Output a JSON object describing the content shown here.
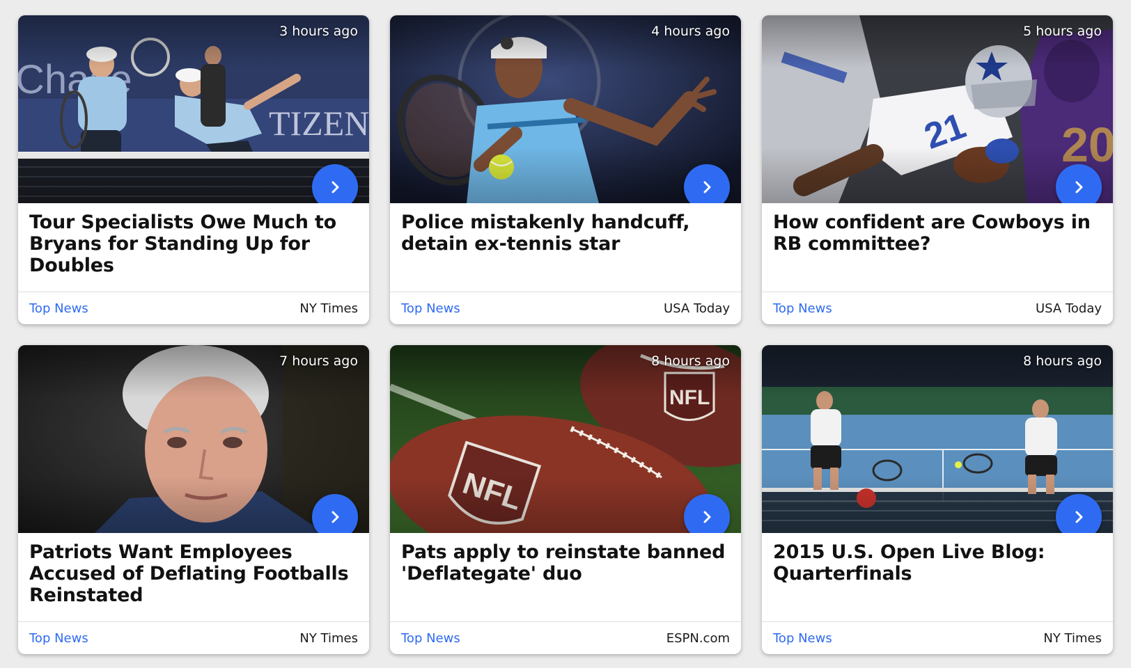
{
  "cards": [
    {
      "time": "3 hours ago",
      "headline": "Tour Specialists Owe Much to Bryans for Standing Up for Doubles",
      "category": "Top News",
      "source": "NY Times",
      "image_alt": "Doubles tennis players at net",
      "image_text": [
        "Chase",
        "TIZEN"
      ]
    },
    {
      "time": "4 hours ago",
      "headline": "Police mistakenly handcuff, detain ex-tennis star",
      "category": "Top News",
      "source": "USA Today",
      "image_alt": "Tennis player hitting forehand"
    },
    {
      "time": "5 hours ago",
      "headline": "How confident are Cowboys in RB committee?",
      "category": "Top News",
      "source": "USA Today",
      "image_alt": "Cowboys running back carrying the ball"
    },
    {
      "time": "7 hours ago",
      "headline": "Patriots Want Employees Accused of Deflating Footballs Reinstated",
      "category": "Top News",
      "source": "NY Times",
      "image_alt": "Portrait of team owner"
    },
    {
      "time": "8 hours ago",
      "headline": "Pats apply to reinstate banned 'Deflategate' duo",
      "category": "Top News",
      "source": "ESPN.com",
      "image_alt": "Footballs on grass",
      "image_text": [
        "NFL",
        "NFL"
      ]
    },
    {
      "time": "8 hours ago",
      "headline": "2015 U.S. Open Live Blog: Quarterfinals",
      "category": "Top News",
      "source": "NY Times",
      "image_alt": "Doubles players on blue tennis court"
    }
  ],
  "colors": {
    "accent": "#2f6bf2",
    "page_background": "#ececec",
    "card_background": "#ffffff"
  },
  "icons": {
    "card_action": "chevron-right-icon"
  }
}
